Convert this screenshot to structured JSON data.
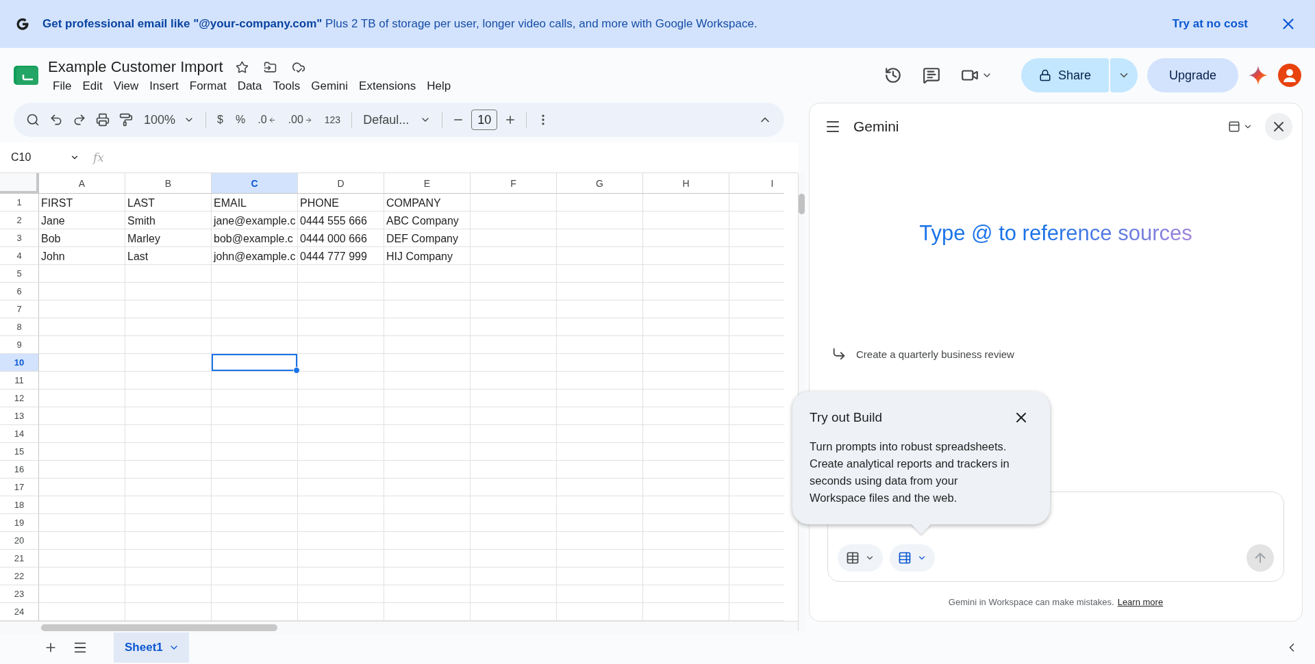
{
  "banner": {
    "message": "**Get professional email like \"@your-company.com\"** Plus 2 TB of storage per user, longer video calls, and more with Google Workspace.",
    "action": "Try at no cost"
  },
  "document": {
    "title": "Example Customer Import",
    "menus": [
      "File",
      "Edit",
      "View",
      "Insert",
      "Format",
      "Data",
      "Tools",
      "Gemini",
      "Extensions",
      "Help"
    ]
  },
  "header_buttons": {
    "share": "Share",
    "upgrade": "Upgrade"
  },
  "toolbar": {
    "zoom": "100%",
    "format_items": [
      {
        "kind": "plain",
        "label": "$"
      },
      {
        "kind": "plain",
        "label": "%"
      },
      {
        "kind": "decrease",
        "label": ".0"
      },
      {
        "kind": "increase",
        "label": ".00"
      },
      {
        "kind": "plain",
        "label": "123"
      }
    ],
    "font": "Defaul...",
    "font_size": "10"
  },
  "formula_bar": {
    "name_box": "C10",
    "formula_label": "fx"
  },
  "grid": {
    "columns": [
      {
        "label": "A",
        "selected": false
      },
      {
        "label": "B",
        "selected": false
      },
      {
        "label": "C",
        "selected": true
      },
      {
        "label": "D",
        "selected": false
      },
      {
        "label": "E",
        "selected": false
      },
      {
        "label": "F",
        "selected": false
      },
      {
        "label": "G",
        "selected": false
      },
      {
        "label": "H",
        "selected": false
      },
      {
        "label": "I",
        "selected": false
      }
    ],
    "rows": [
      {
        "label": "1",
        "selected": false,
        "cells": [
          "FIRST",
          "LAST",
          "EMAIL",
          "PHONE",
          "COMPANY"
        ]
      },
      {
        "label": "2",
        "selected": false,
        "cells": [
          "Jane",
          "Smith",
          "jane@example.c",
          "0444 555 666",
          "ABC Company"
        ]
      },
      {
        "label": "3",
        "selected": false,
        "cells": [
          "Bob",
          "Marley",
          "bob@example.c",
          "0444 000 666",
          "DEF Company"
        ]
      },
      {
        "label": "4",
        "selected": false,
        "cells": [
          "John",
          "Last",
          "john@example.c",
          "0444 777 999",
          "HIJ Company"
        ]
      },
      {
        "label": "5",
        "selected": false
      },
      {
        "label": "6",
        "selected": false
      },
      {
        "label": "7",
        "selected": false
      },
      {
        "label": "8",
        "selected": false
      },
      {
        "label": "9",
        "selected": false
      },
      {
        "label": "10",
        "selected": true
      },
      {
        "label": "11",
        "selected": false
      },
      {
        "label": "12",
        "selected": false
      },
      {
        "label": "13",
        "selected": false
      },
      {
        "label": "14",
        "selected": false
      },
      {
        "label": "15",
        "selected": false
      },
      {
        "label": "16",
        "selected": false
      },
      {
        "label": "17",
        "selected": false
      },
      {
        "label": "18",
        "selected": false
      },
      {
        "label": "19",
        "selected": false
      },
      {
        "label": "20",
        "selected": false
      },
      {
        "label": "21",
        "selected": false
      },
      {
        "label": "22",
        "selected": false
      },
      {
        "label": "23",
        "selected": false
      },
      {
        "label": "24",
        "selected": false
      }
    ]
  },
  "gemini": {
    "title": "Gemini",
    "headline": "Type @ to reference sources",
    "suggestion": "Create a quarterly business review",
    "disclaimer": "Gemini in Workspace can make mistakes.",
    "disclaimer_link": "Learn more"
  },
  "popup": {
    "title": "Try out Build",
    "body": "Turn prompts into robust spreadsheets. Create analytical reports and trackers in seconds using data from your Workspace files and the web."
  },
  "sheet_tabs": [
    {
      "label": "Sheet1",
      "selected": true
    }
  ]
}
